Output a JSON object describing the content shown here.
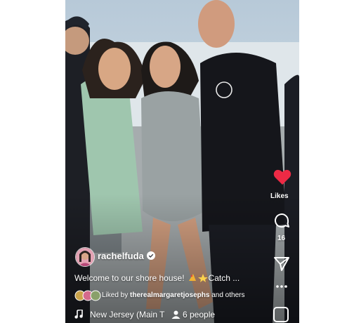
{
  "post": {
    "username": "rachelfuda",
    "caption": "Welcome to our shore house!",
    "caption_suffix": "Catch ...",
    "liked_by_prefix": "Liked by",
    "liked_by_user": "therealmargaretjosephs",
    "liked_by_suffix": "and others",
    "audio_label": "New Jersey (Main T",
    "people_tagged": "6 people"
  },
  "actions": {
    "likes_label": "Likes",
    "comment_count": "16"
  },
  "colors": {
    "like_red": "#ed2a45",
    "text": "#ffffff"
  },
  "icons": [
    "verified-badge-icon",
    "heart-icon",
    "comment-icon",
    "share-icon",
    "more-icon",
    "music-note-icon",
    "person-icon",
    "audio-thumbnail-icon"
  ]
}
